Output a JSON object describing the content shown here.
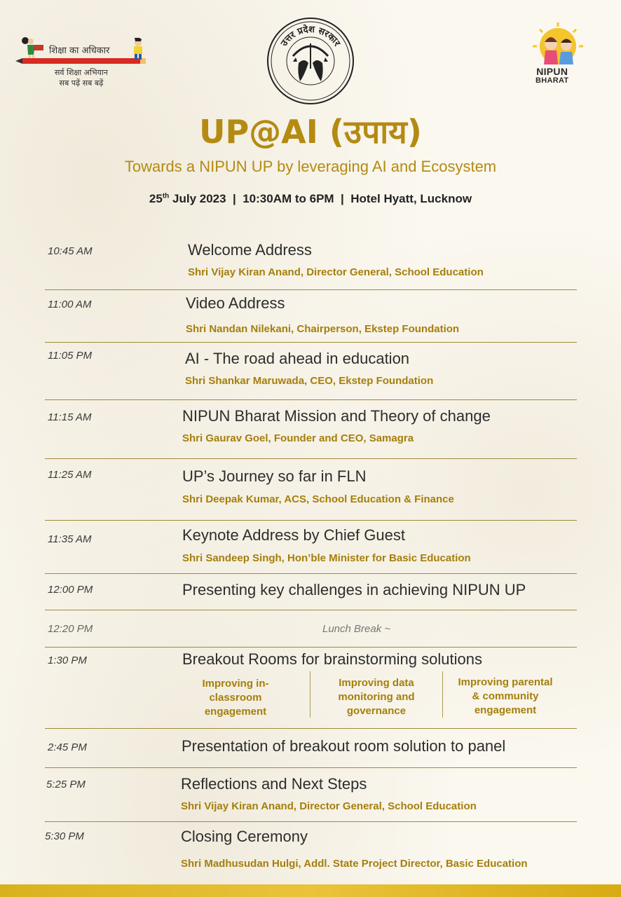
{
  "header": {
    "left_logo": {
      "line1": "शिक्षा का अधिकार",
      "line2": "सर्व शिक्षा अभियान",
      "line3": "सब पढ़ें सब बढ़ें"
    },
    "center_emblem": {
      "text": "उत्तर प्रदेश सरकार",
      "icon": "up-government-emblem-icon"
    },
    "right_logo": {
      "line1": "NIPUN",
      "line2": "BHARAT",
      "icon": "nipun-bharat-children-icon"
    }
  },
  "event": {
    "title": "UP@AI (उपाय)",
    "subtitle": "Towards a NIPUN UP by leveraging AI and Ecosystem",
    "date_day": "25",
    "date_suffix": "th",
    "date_rest": " July 2023  |  10:30AM to 6PM  |  Hotel Hyatt, Lucknow"
  },
  "agenda": [
    {
      "time": "10:45 AM",
      "title": "Welcome Address",
      "speaker": "Shri Vijay Kiran Anand, Director General, School Education"
    },
    {
      "time": "11:00 AM",
      "title": "Video Address",
      "speaker": "Shri Nandan Nilekani, Chairperson, Ekstep Foundation"
    },
    {
      "time": "11:05 PM",
      "title": "AI - The road ahead in education",
      "speaker": "Shri Shankar Maruwada, CEO, Ekstep Foundation"
    },
    {
      "time": "11:15 AM",
      "title": "NIPUN Bharat Mission and Theory of change",
      "speaker": "Shri Gaurav Goel, Founder and CEO, Samagra"
    },
    {
      "time": "11:25 AM",
      "title": "UP’s Journey so far in FLN",
      "speaker": "Shri Deepak Kumar, ACS, School Education & Finance"
    },
    {
      "time": "11:35 AM",
      "title": "Keynote Address by Chief Guest",
      "speaker": "Shri Sandeep Singh, Hon’ble Minister for Basic Education"
    },
    {
      "time": "12:00 PM",
      "title": "Presenting key challenges in achieving NIPUN UP"
    },
    {
      "time": "12:20 PM",
      "note": "Lunch Break ~"
    },
    {
      "time": "1:30 PM",
      "title": "Breakout Rooms for brainstorming solutions",
      "breakouts": [
        [
          "Improving in-",
          "classroom",
          "engagement"
        ],
        [
          "Improving data",
          "monitoring and",
          "governance"
        ],
        [
          "Improving parental",
          "& community",
          "engagement"
        ]
      ]
    },
    {
      "time": "2:45 PM",
      "title": "Presentation of breakout room solution to panel"
    },
    {
      "time": "5:25 PM",
      "title": "Reflections and Next Steps",
      "speaker": "Shri Vijay Kiran Anand, Director General, School Education"
    },
    {
      "time": "5:30 PM",
      "title": "Closing Ceremony",
      "speaker": "Shri Madhusudan Hulgi, Addl. State Project Director, Basic Education"
    }
  ]
}
